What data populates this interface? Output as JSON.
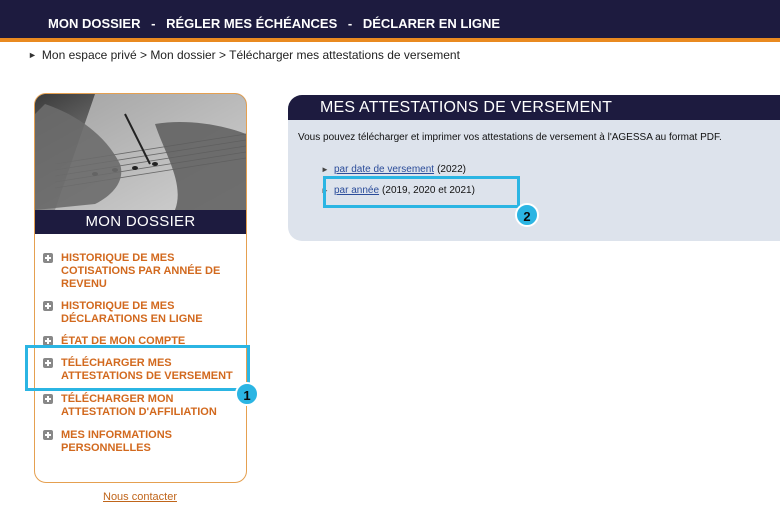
{
  "top_nav": {
    "item1": "MON DOSSIER",
    "item2": "RÉGLER MES ÉCHÉANCES",
    "item3": "DÉCLARER EN LIGNE",
    "separator": "-"
  },
  "breadcrumb": "Mon espace privé > Mon dossier > Télécharger mes attestations de versement",
  "sidebar": {
    "title": "MON DOSSIER",
    "items": [
      {
        "label": "HISTORIQUE DE MES COTISATIONS PAR ANNÉE DE REVENU"
      },
      {
        "label": "HISTORIQUE DE MES DÉCLARATIONS EN LIGNE"
      },
      {
        "label": "ÉTAT DE MON COMPTE"
      },
      {
        "label": "TÉLÉCHARGER MES ATTESTATIONS DE VERSEMENT"
      },
      {
        "label": "TÉLÉCHARGER MON ATTESTATION D'AFFILIATION"
      },
      {
        "label": "MES INFORMATIONS PERSONNELLES"
      }
    ],
    "contact": "Nous contacter"
  },
  "panel": {
    "title": "MES ATTESTATIONS DE VERSEMENT",
    "description": "Vous pouvez télécharger et imprimer vos attestations de versement à l'AGESSA au format PDF.",
    "links": [
      {
        "label": "par date de versement",
        "suffix": "(2022)"
      },
      {
        "label": "par année",
        "suffix": "(2019, 2020 et 2021)"
      }
    ]
  },
  "annotations": {
    "badge1": "1",
    "badge2": "2",
    "highlight_color": "#2bb5e3"
  },
  "colors": {
    "nav_bg": "#1d1b3f",
    "accent_orange": "#e98a20",
    "menu_text": "#d2691e",
    "panel_bg": "#dde3ec"
  }
}
